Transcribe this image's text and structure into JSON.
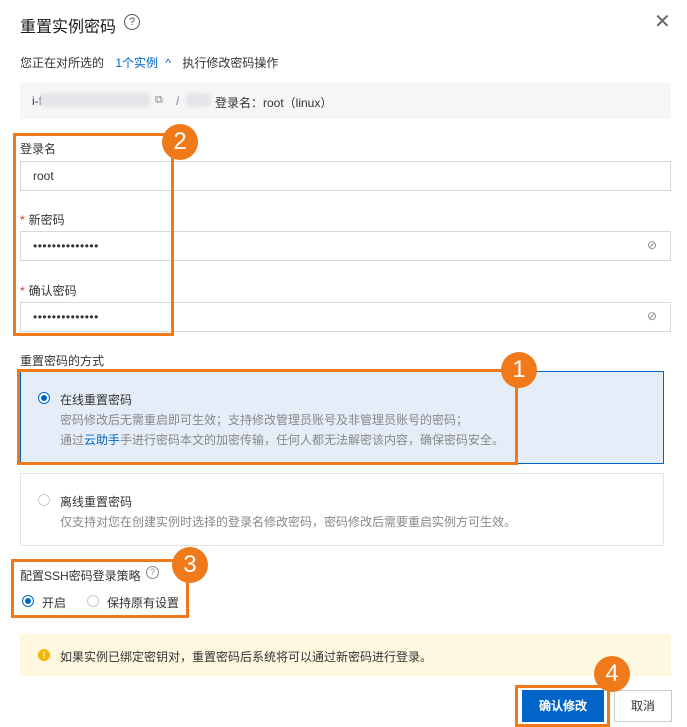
{
  "dialog": {
    "title": "重置实例密码",
    "help_icon": "?",
    "close_icon": "✕"
  },
  "scope": {
    "prefix": "您正在对所选的",
    "instance_count": "1个实例",
    "caret": "^",
    "suffix": "执行修改密码操作"
  },
  "instance": {
    "id_prefix": "i-f",
    "slash": "/",
    "login_info": "登录名：root（linux）"
  },
  "form": {
    "username": {
      "label": "登录名",
      "value": "root"
    },
    "new_password": {
      "required_mark": "*",
      "label": "新密码",
      "value": "••••••••••••••"
    },
    "confirm_password": {
      "required_mark": "*",
      "label": "确认密码",
      "value": "••••••••••••••"
    }
  },
  "reset_mode": {
    "label": "重置密码的方式",
    "options": [
      {
        "title": "在线重置密码",
        "desc_line1": "密码修改后无需重启即可生效；支持修改管理员账号及非管理员账号的密码；",
        "desc_line2_pre": "通过",
        "desc_line2_link": "云助手",
        "desc_line2_post": "手进行密码本文的加密传输，任何人都无法解密该内容，确保密码安全。",
        "selected": true
      },
      {
        "title": "离线重置密码",
        "desc_line1": "仅支持对您在创建实例时选择的登录名修改密码，密码修改后需要重启实例方可生效。",
        "selected": false
      }
    ]
  },
  "ssh_policy": {
    "label": "配置SSH密码登录策略",
    "help_icon": "?",
    "options": [
      {
        "label": "开启",
        "selected": true
      },
      {
        "label": "保持原有设置",
        "selected": false
      }
    ]
  },
  "notice": {
    "icon": "!",
    "text": "如果实例已绑定密钥对，重置密码后系统将可以通过新密码进行登录。"
  },
  "footer": {
    "confirm_label": "确认修改",
    "cancel_label": "取消"
  },
  "annotations": {
    "badge_1": "1",
    "badge_2": "2",
    "badge_3": "3",
    "badge_4": "4"
  },
  "colors": {
    "accent": "#0064c8",
    "annotation": "#f07a1a",
    "required": "#d93026",
    "notice_bg": "#fff8e1"
  },
  "icons": {
    "help": "question-circle-icon",
    "close": "close-icon",
    "copy": "copy-icon",
    "eye": "eye-slash-icon",
    "warning": "warning-icon"
  }
}
